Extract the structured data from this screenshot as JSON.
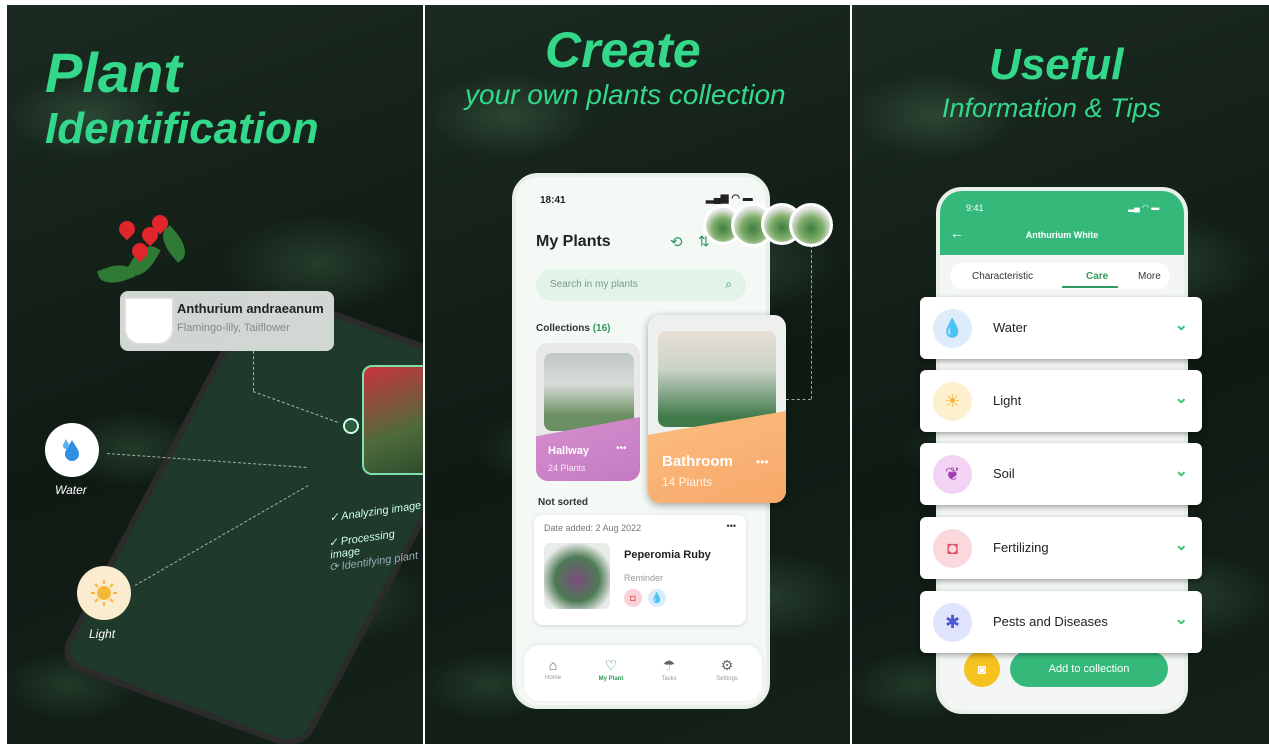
{
  "panel1": {
    "title_line1": "Plant",
    "title_line2": "Identification",
    "plant_name": "Anthurium andraeanum",
    "plant_common": "Flamingo-lily, Tailflower",
    "water_label": "Water",
    "light_label": "Light",
    "steps": [
      "✓ Analyzing image",
      "✓ Processing image",
      "⟳ Identifying plant"
    ]
  },
  "panel2": {
    "title": "Create",
    "subtitle": "your own plants collection",
    "time": "18:41",
    "header": "My Plants",
    "search_placeholder": "Search in my plants",
    "collections_label": "Collections",
    "collections_count": "(16)",
    "collections": [
      {
        "name": "Hallway",
        "count": "24 Plants"
      },
      {
        "name": "Bathroom",
        "count": "14 Plants"
      }
    ],
    "not_sorted": "Not sorted",
    "date_added": "Date added: 2 Aug 2022",
    "plant_name": "Peperomia Ruby",
    "reminder_label": "Reminder",
    "more_dots": "•••",
    "nav": [
      "Home",
      "My Plant",
      "Tasks",
      "Settings"
    ]
  },
  "panel3": {
    "title": "Useful",
    "subtitle": "Information & Tips",
    "time": "9:41",
    "plant_title": "Anthurium White",
    "tabs": [
      "Characteristic",
      "Care",
      "More"
    ],
    "care_items": [
      "Water",
      "Light",
      "Soil",
      "Fertilizing",
      "Pests and Diseases"
    ],
    "add_button": "Add to collection"
  },
  "colors": {
    "accent": "#33d88a",
    "dark_green": "#2e9a5d"
  }
}
